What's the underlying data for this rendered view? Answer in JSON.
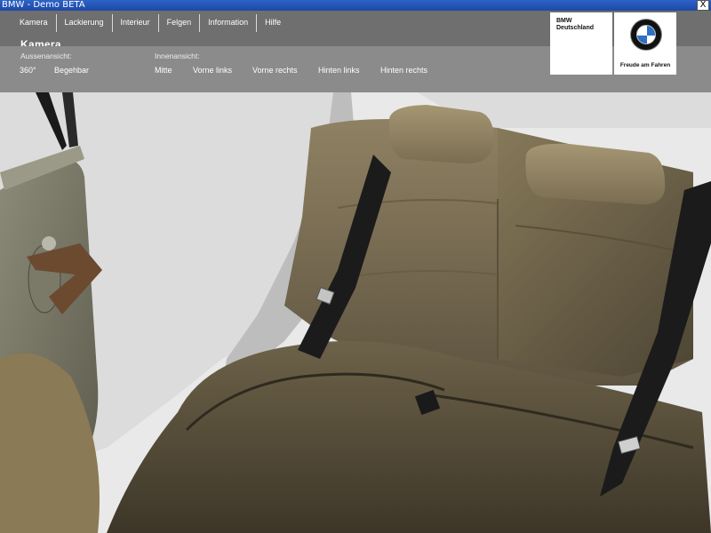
{
  "window": {
    "title": "BMW - Demo BETA",
    "close_glyph": "X"
  },
  "menu": {
    "items": [
      "Kamera",
      "Lackierung",
      "Interieur",
      "Felgen",
      "Information",
      "Hilfe"
    ]
  },
  "section_title": "Kamera",
  "camera": {
    "exterior_label": "Aussenansicht:",
    "exterior_options": [
      "360°",
      "Begehbar"
    ],
    "interior_label": "Innenansicht:",
    "interior_options": [
      "Mitte",
      "Vorne links",
      "Vorne rechts",
      "Hinten links",
      "Hinten rechts"
    ]
  },
  "logos": {
    "dealer_line1": "BMW",
    "dealer_line2": "Deutschland",
    "slogan": "Freude am Fahren",
    "roundel_letters": "BMW"
  },
  "colors": {
    "title_bar": "#1d48a6",
    "menu_bg": "#6f6f6f",
    "option_bg": "#8b8b8b",
    "bmw_blue": "#2f6fc4"
  }
}
